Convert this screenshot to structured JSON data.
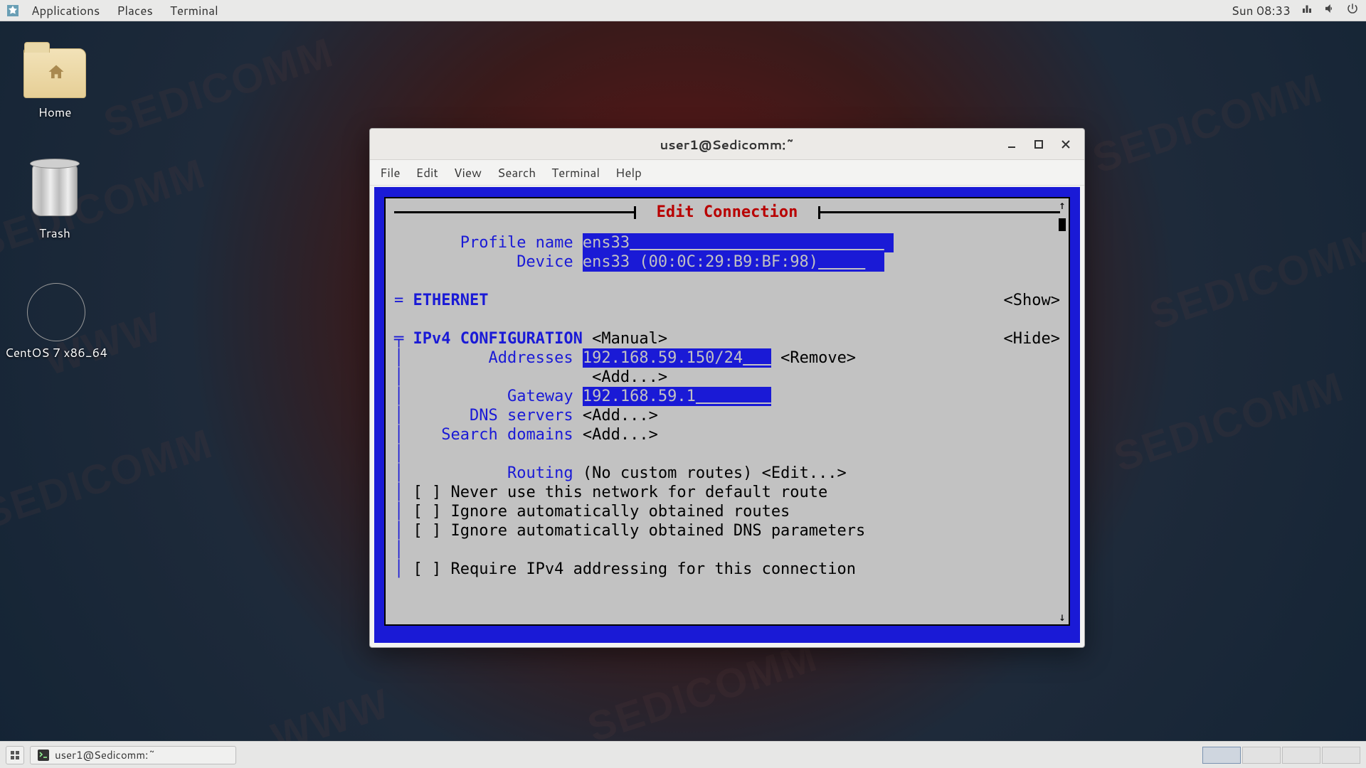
{
  "panel": {
    "applications": "Applications",
    "places": "Places",
    "terminal": "Terminal",
    "clock": "Sun 08:33"
  },
  "desktop_icons": {
    "home": "Home",
    "trash": "Trash",
    "disc": "CentOS 7 x86_64"
  },
  "taskbar": {
    "task1": "user1@Sedicomm:~"
  },
  "window": {
    "title": "user1@Sedicomm:~",
    "menus": {
      "file": "File",
      "edit": "Edit",
      "view": "View",
      "search": "Search",
      "terminal": "Terminal",
      "help": "Help"
    }
  },
  "tui": {
    "title": " Edit Connection ",
    "profile_label": "Profile name",
    "profile_value": "ens33",
    "device_label": "Device",
    "device_value": "ens33 (00:0C:29:B9:BF:98)",
    "eth_marker": "=",
    "eth_label": "ETHERNET",
    "show": "<Show>",
    "ipv4_marker": "╤",
    "ipv4_label": "IPv4 CONFIGURATION",
    "ipv4_mode": "<Manual>",
    "hide": "<Hide>",
    "addresses_label": "Addresses",
    "address_value": "192.168.59.150/24",
    "remove": "<Remove>",
    "add": "<Add...>",
    "gateway_label": "Gateway",
    "gateway_value": "192.168.59.1",
    "dns_label": "DNS servers",
    "search_label": "Search domains",
    "routing_label": "Routing",
    "routing_value": "(No custom routes)",
    "edit": "<Edit...>",
    "cb1": "[ ] Never use this network for default route",
    "cb2": "[ ] Ignore automatically obtained routes",
    "cb3": "[ ] Ignore automatically obtained DNS parameters",
    "cb4": "[ ] Require IPv4 addressing for this connection"
  }
}
